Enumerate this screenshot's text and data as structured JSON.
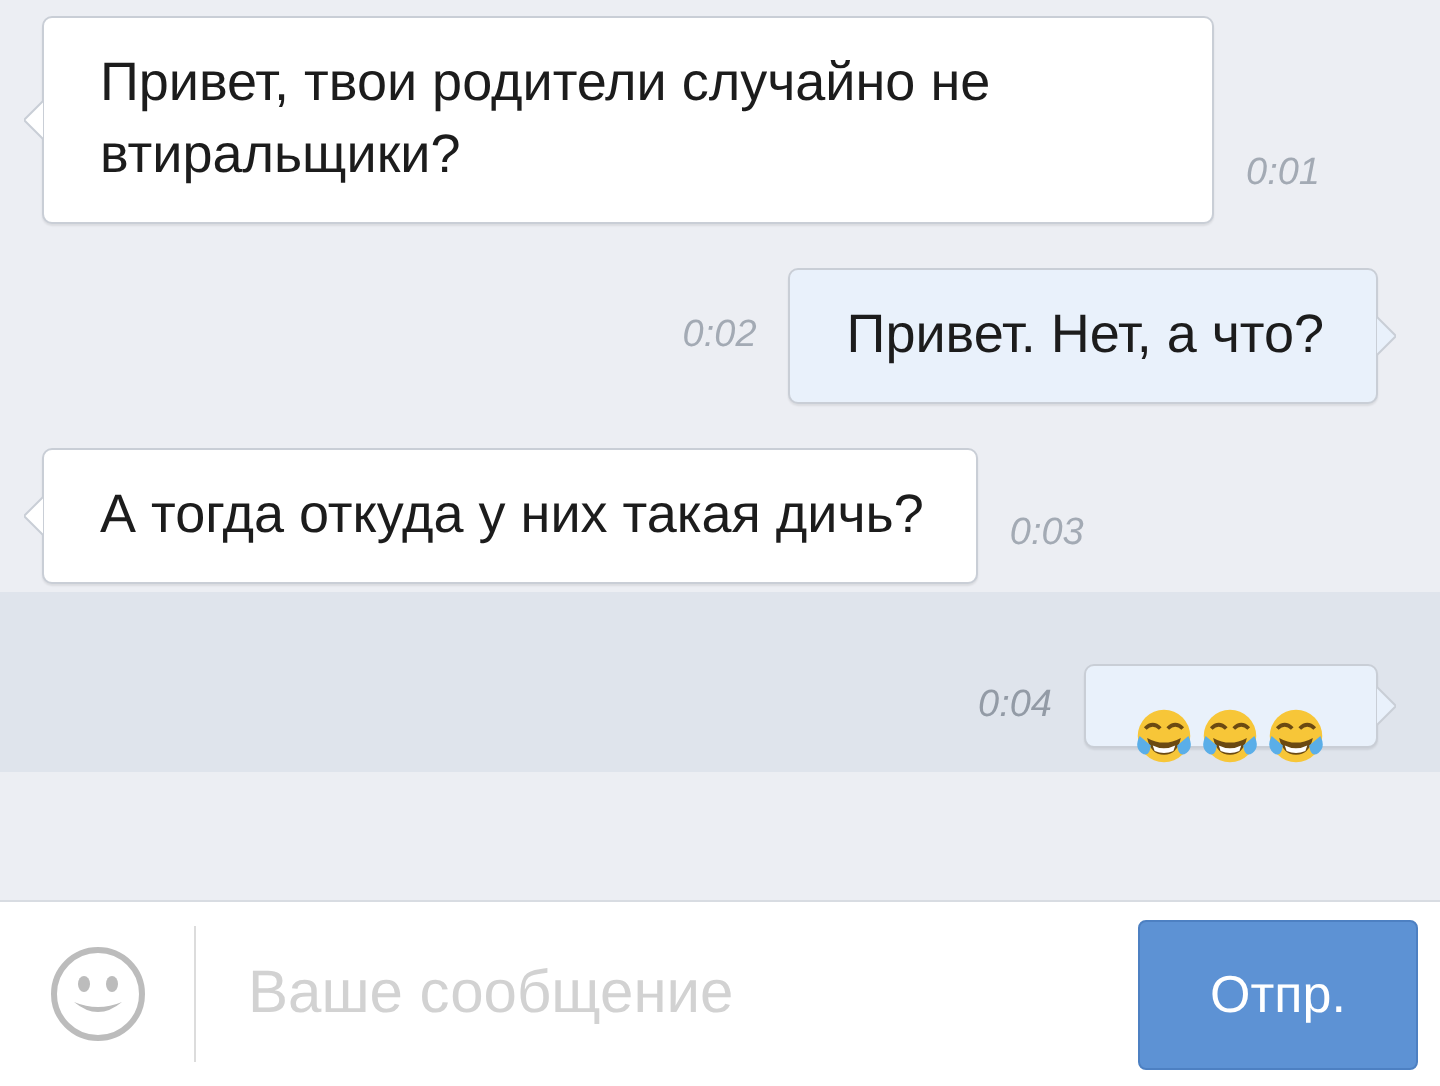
{
  "messages": [
    {
      "kind": "text",
      "outgoing": false,
      "text": "Привет, твои родители случайно не втиральщики?",
      "time": "0:01",
      "highlighted": false
    },
    {
      "kind": "text",
      "outgoing": true,
      "text": "Привет. Нет, а что?",
      "time": "0:02",
      "highlighted": false
    },
    {
      "kind": "text",
      "outgoing": false,
      "text": "А тогда откуда у них такая дичь?",
      "time": "0:03",
      "highlighted": false
    },
    {
      "kind": "emoji",
      "outgoing": true,
      "emojis": [
        {
          "kind": "tears-of-joy"
        },
        {
          "kind": "tears-of-joy"
        },
        {
          "kind": "tears-of-joy"
        }
      ],
      "time": "0:04",
      "highlighted": true
    }
  ],
  "composer": {
    "placeholder": "Ваше сообщение",
    "send_button": "Отпр."
  }
}
